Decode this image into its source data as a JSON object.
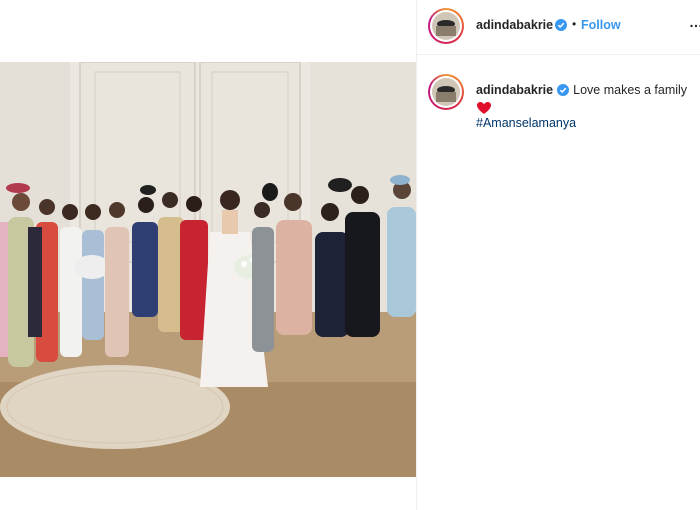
{
  "post": {
    "username": "adindabakrie",
    "follow_label": "Follow",
    "separator": "•",
    "more_label": "…",
    "caption": {
      "username": "adindabakrie",
      "text": "Love makes a family",
      "emoji": "heart-emoji",
      "hashtag": "#Amanselamanya"
    }
  },
  "colors": {
    "link": "#3897f0",
    "hashtag": "#003569",
    "verified": "#3897f0",
    "heart": "#e0102d"
  }
}
